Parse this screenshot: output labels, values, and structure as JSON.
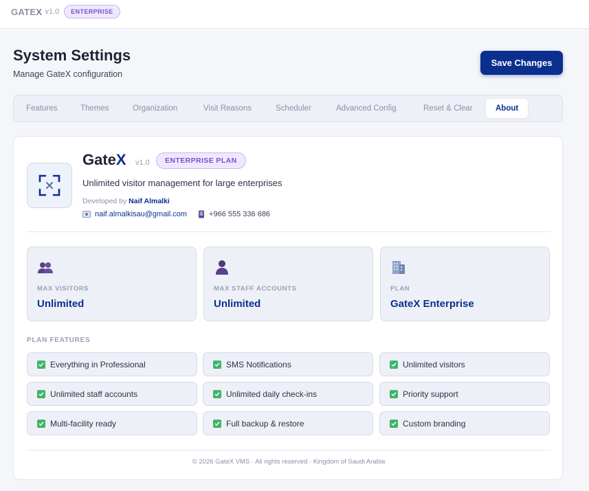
{
  "topbar": {
    "brand_main": "GATE",
    "brand_x": "X",
    "version": "v1.0",
    "edition_badge": "ENTERPRISE"
  },
  "header": {
    "title": "System Settings",
    "subtitle": "Manage GateX configuration",
    "save_label": "Save Changes"
  },
  "tabs": [
    {
      "label": "Features"
    },
    {
      "label": "Themes"
    },
    {
      "label": "Organization"
    },
    {
      "label": "Visit Reasons"
    },
    {
      "label": "Scheduler"
    },
    {
      "label": "Advanced Config"
    },
    {
      "label": "Reset & Clear"
    },
    {
      "label": "About"
    }
  ],
  "active_tab": "About",
  "about": {
    "app_name_main": "Gate",
    "app_name_x": "X",
    "version": "v1.0",
    "plan_badge": "ENTERPRISE PLAN",
    "description": "Unlimited visitor management for large enterprises",
    "developed_by_label": "Developed by",
    "developer": "Naif Almalki",
    "email": "naif.almalkisau@gmail.com",
    "phone": "+966 555 336 686"
  },
  "stats": [
    {
      "label": "MAX VISITORS",
      "value": "Unlimited",
      "icon": "visitors-icon"
    },
    {
      "label": "MAX STAFF ACCOUNTS",
      "value": "Unlimited",
      "icon": "staff-icon"
    },
    {
      "label": "PLAN",
      "value": "GateX Enterprise",
      "icon": "building-icon"
    }
  ],
  "features": {
    "title": "PLAN FEATURES",
    "items": [
      "Everything in Professional",
      "SMS Notifications",
      "Unlimited visitors",
      "Unlimited staff accounts",
      "Unlimited daily check-ins",
      "Priority support",
      "Multi-facility ready",
      "Full backup & restore",
      "Custom branding"
    ]
  },
  "footer": "© 2026 GateX VMS · All rights reserved · Kingdom of Saudi Arabia",
  "colors": {
    "accent": "#0b2f8f",
    "badge_purple": "#7a4fd0",
    "check_green": "#3fb56a"
  }
}
